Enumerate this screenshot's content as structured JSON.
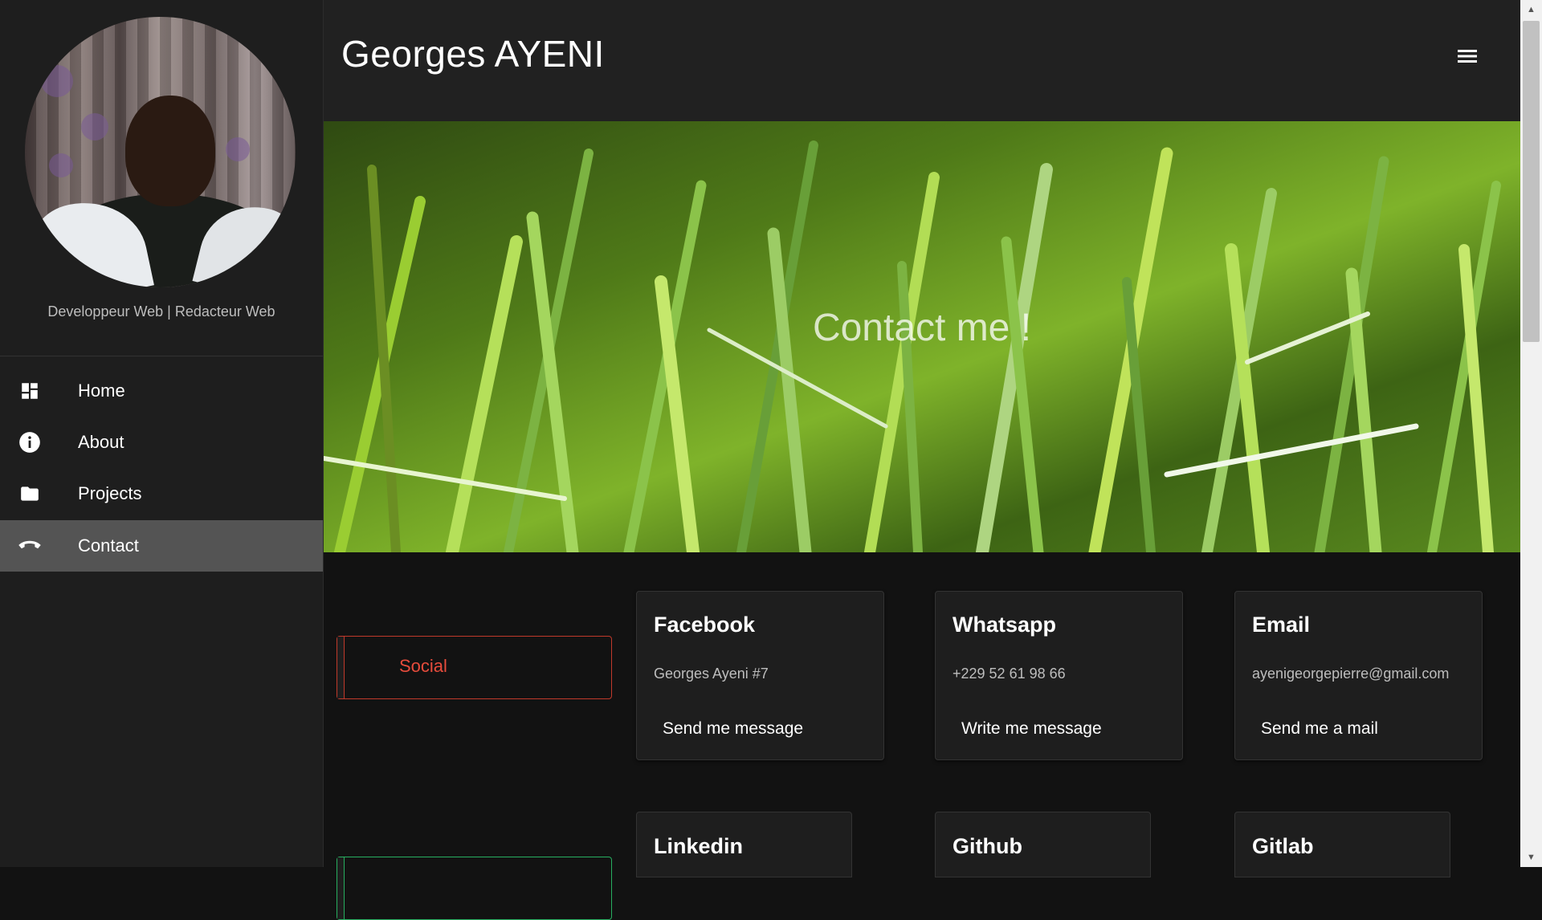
{
  "sidebar": {
    "tagline": "Developpeur Web | Redacteur Web",
    "nav": [
      {
        "label": "Home",
        "icon": "dashboard-icon",
        "active": false
      },
      {
        "label": "About",
        "icon": "info-icon",
        "active": false
      },
      {
        "label": "Projects",
        "icon": "folder-icon",
        "active": false
      },
      {
        "label": "Contact",
        "icon": "phone-hangup-icon",
        "active": true
      }
    ]
  },
  "header": {
    "title": "Georges AYENI",
    "menu_icon": "hamburger-menu-icon"
  },
  "banner": {
    "title": "Contact me !"
  },
  "sections": {
    "social": {
      "label": "Social",
      "accent": "#e74c3c"
    },
    "next": {
      "accent": "#27ae60"
    }
  },
  "cards": [
    {
      "title": "Facebook",
      "detail": "Georges Ayeni #7",
      "action": "Send me message"
    },
    {
      "title": "Whatsapp",
      "detail": "+229 52 61 98 66",
      "action": "Write me message"
    },
    {
      "title": "Email",
      "detail": "ayenigeorgepierre@gmail.com",
      "action": "Send me a mail"
    }
  ],
  "cards_row2": [
    {
      "title": "Linkedin"
    },
    {
      "title": "Github"
    },
    {
      "title": "Gitlab"
    }
  ],
  "colors": {
    "sidebar_bg": "#1e1e1e",
    "header_bg": "#212121",
    "page_bg": "#121212",
    "active_nav_bg": "#545454"
  }
}
